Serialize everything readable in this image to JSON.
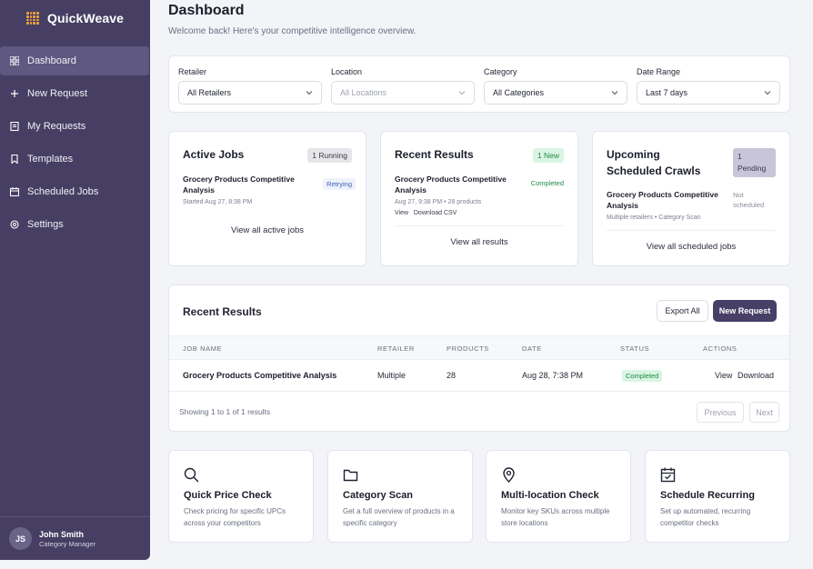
{
  "app": {
    "name": "QuickWeave"
  },
  "sidebar": {
    "items": [
      {
        "label": "Dashboard",
        "icon": "grid-icon",
        "active": true
      },
      {
        "label": "New Request",
        "icon": "plus-icon"
      },
      {
        "label": "My Requests",
        "icon": "document-icon"
      },
      {
        "label": "Templates",
        "icon": "bookmark-icon"
      },
      {
        "label": "Scheduled Jobs",
        "icon": "calendar-icon"
      },
      {
        "label": "Settings",
        "icon": "gear-icon"
      }
    ],
    "user": {
      "initials": "JS",
      "name": "John Smith",
      "role": "Category Manager"
    }
  },
  "header": {
    "title": "Dashboard",
    "subtitle": "Welcome back! Here's your competitive intelligence overview."
  },
  "filters": {
    "retailer": {
      "label": "Retailer",
      "value": "All Retailers"
    },
    "location": {
      "label": "Location",
      "value": "All Locations"
    },
    "category": {
      "label": "Category",
      "value": "All Categories"
    },
    "date_range": {
      "label": "Date Range",
      "value": "Last 7 days"
    }
  },
  "active_jobs": {
    "title": "Active Jobs",
    "badge": "1 Running",
    "job_name": "Grocery Products Competitive Analysis",
    "job_status": "Retrying",
    "job_meta": "Started Aug 27, 8:38 PM",
    "link": "View all active jobs"
  },
  "recent_results_card": {
    "title": "Recent Results",
    "badge": "1 New",
    "job_name": "Grocery Products Competitive Analysis",
    "job_status": "Completed",
    "job_meta": "Aug 27, 9:38 PM • 28 products",
    "actions": "View   Download CSV",
    "link": "View all results"
  },
  "scheduled_card": {
    "title": "Upcoming Scheduled Crawls",
    "badge": "1 Pending",
    "job_name": "Grocery Products Competitive Analysis",
    "job_status": "Not scheduled",
    "job_meta": "Multiple retailers • Category Scan",
    "link": "View all scheduled jobs"
  },
  "results_table": {
    "title": "Recent Results",
    "export_label": "Export All",
    "new_request_label": "New Request",
    "columns": [
      "JOB NAME",
      "RETAILER",
      "PRODUCTS",
      "DATE",
      "STATUS",
      "ACTIONS"
    ],
    "rows": [
      {
        "job_name": "Grocery Products Competitive Analysis",
        "retailer": "Multiple",
        "products": "28",
        "date": "Aug 28, 7:38 PM",
        "status": "Completed",
        "view": "View",
        "download": "Download"
      }
    ],
    "showing": "Showing 1 to 1 of 1 results",
    "previous": "Previous",
    "next": "Next"
  },
  "quick_actions": [
    {
      "title": "Quick Price Check",
      "desc": "Check pricing for specific UPCs across your competitors",
      "icon": "search-icon"
    },
    {
      "title": "Category Scan",
      "desc": "Get a full overview of products in a specific category",
      "icon": "folder-icon"
    },
    {
      "title": "Multi-location Check",
      "desc": "Monitor key SKUs across multiple store locations",
      "icon": "location-pin-icon"
    },
    {
      "title": "Schedule Recurring",
      "desc": "Set up automated, recurring competitor checks",
      "icon": "calendar-check-icon"
    }
  ],
  "colors": {
    "sidebar": "#463f63",
    "primary_button": "#473f66",
    "success": "#1f8a47",
    "brand_accent": "#f0a33a"
  }
}
